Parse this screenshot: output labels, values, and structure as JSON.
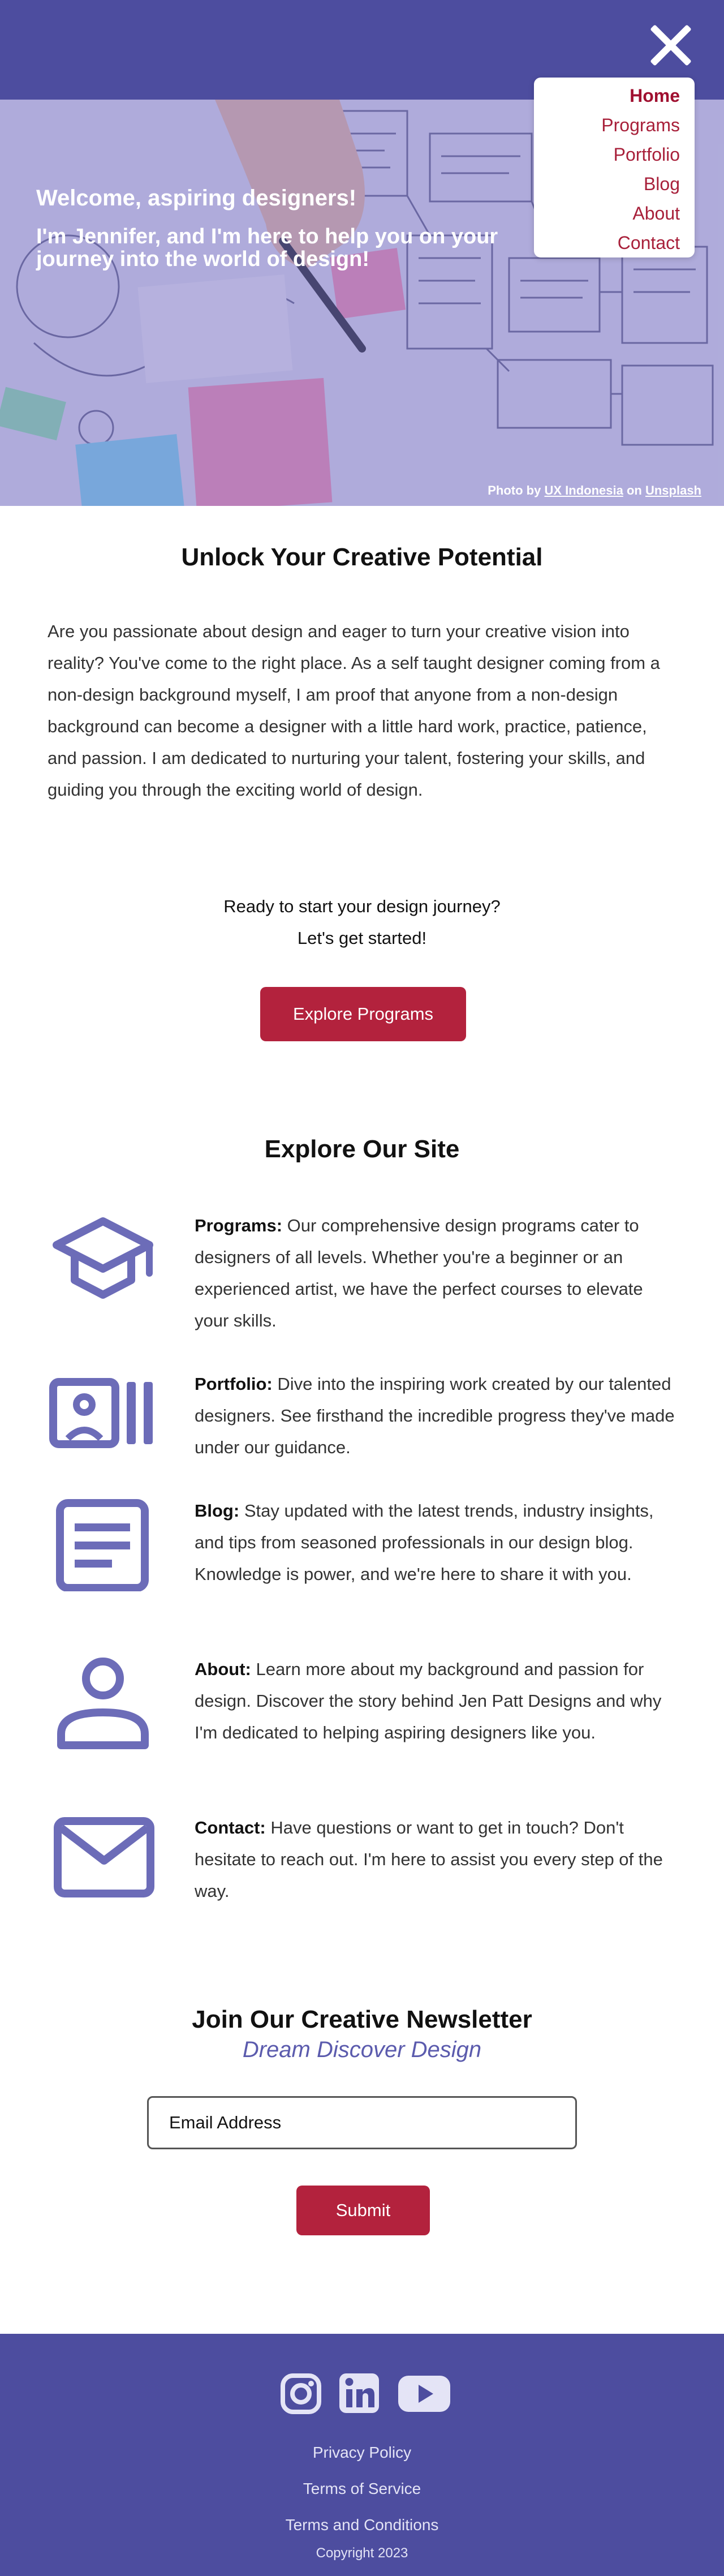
{
  "header": {
    "close_icon": "close-icon"
  },
  "nav": {
    "items": [
      "Home",
      "Programs",
      "Portfolio",
      "Blog",
      "About",
      "Contact"
    ],
    "active": "Home"
  },
  "hero": {
    "welcome": "Welcome, aspiring designers!",
    "intro": "I'm Jennifer, and I'm here to help you on your journey into the world of design!",
    "credit_prefix": "Photo by",
    "credit_author": "UX Indonesia",
    "credit_on": "on",
    "credit_site": "Unsplash"
  },
  "intro": {
    "title": "Unlock Your Creative Potential",
    "body": "Are you passionate about design and eager to turn your creative vision into reality? You've come to the right place. As a self taught designer coming from a non-design background myself, I am proof that anyone from a non-design background can become a designer with a little hard work, practice, patience, and passion. I am dedicated to nurturing your talent, fostering your skills, and guiding you through the exciting world of design.",
    "ready_line1": "Ready to start your design journey?",
    "ready_line2": "Let's get started!",
    "button": "Explore Programs"
  },
  "explore": {
    "title": "Explore Our Site",
    "items": [
      {
        "icon": "graduation-cap-icon",
        "label": "Programs:",
        "text": " Our comprehensive design programs cater to designers of all levels. Whether you're a beginner or an experienced artist, we have the perfect courses to elevate your skills."
      },
      {
        "icon": "portfolio-icon",
        "label": "Portfolio:",
        "text": " Dive into the inspiring work created by our talented designers. See firsthand the incredible progress they've made under our guidance."
      },
      {
        "icon": "article-icon",
        "label": "Blog:",
        "text": " Stay updated with the latest trends, industry insights, and tips from seasoned professionals in our design blog. Knowledge is power, and we're here to share it with you."
      },
      {
        "icon": "person-icon",
        "label": "About:",
        "text": " Learn more about my background and passion for design. Discover the story behind Jen Patt Designs and why I'm dedicated to helping aspiring designers like you."
      },
      {
        "icon": "mail-icon",
        "label": "Contact:",
        "text": " Have questions or want to get in touch? Don't hesitate to reach out. I'm here to assist you every step of the way."
      }
    ]
  },
  "newsletter": {
    "title": "Join Our Creative Newsletter",
    "subtitle": "Dream Discover Design",
    "email_placeholder": "Email Address",
    "submit": "Submit"
  },
  "footer": {
    "social_icons": [
      "instagram-icon",
      "linkedin-icon",
      "youtube-icon"
    ],
    "links": [
      "Privacy Policy",
      "Terms of Service",
      "Terms and Conditions"
    ],
    "copyright": "Copyright 2023"
  },
  "colors": {
    "brand_purple": "#4d4d9f",
    "accent_red": "#b3223d",
    "icon_purple": "#6c6cb8",
    "subtitle_purple": "#5b5bad"
  }
}
